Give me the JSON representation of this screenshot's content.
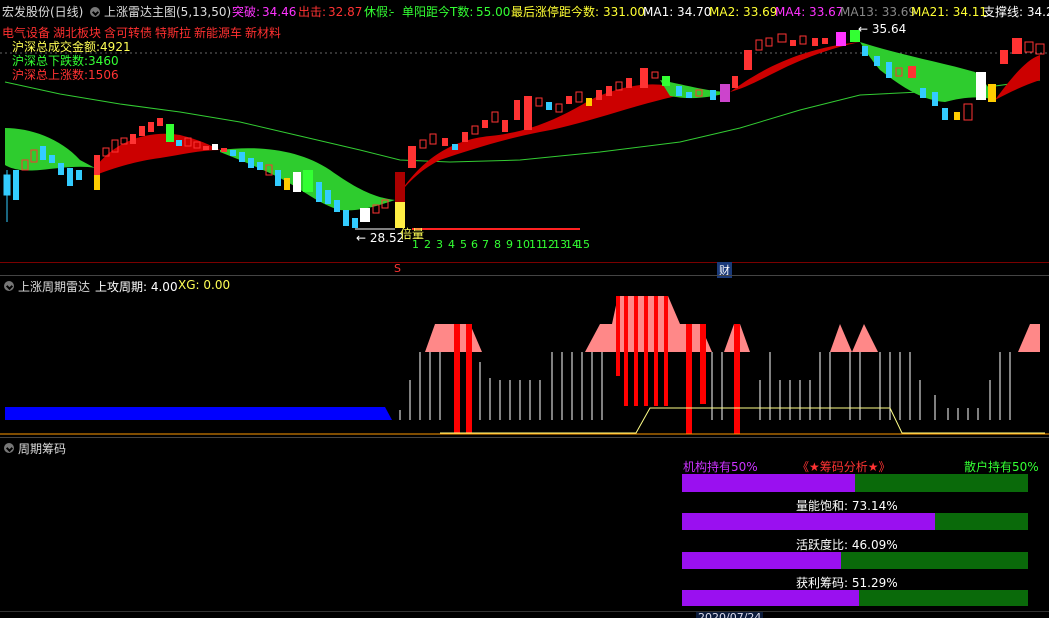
{
  "header": {
    "stock": "宏发股份(日线)",
    "indicator": "上涨雷达主图(5,13,50)",
    "breakout_label": "突破:",
    "breakout_value": "34.46",
    "exit_label": "出击:",
    "exit_value": "32.87",
    "rest_label": "休假:",
    "rest_value": "-",
    "single_sun_label": "单阳距今T数:",
    "single_sun_value": "55.00",
    "last_limit_label": "最后涨停距今数:",
    "last_limit_value": "331.00",
    "ma1": "MA1: 34.70",
    "ma2": "MA2: 33.69",
    "ma4": "MA4: 33.67",
    "ma13": "MA13: 33.69",
    "ma21": "MA21: 34.11",
    "support": "支撑线: 34.2"
  },
  "sectors": [
    "电气设备",
    "湖北板块",
    "含可转债",
    "特斯拉",
    "新能源车",
    "新材料"
  ],
  "market_stats": {
    "turnover": "沪深总成交金额:4921",
    "down": "沪深总下跌数:3460",
    "up": "沪深总上涨数:1506"
  },
  "chart_annotations": {
    "high": "35.64",
    "low": "28.52",
    "volume_tag": "倍量",
    "count_labels": [
      "1",
      "2",
      "3",
      "4",
      "5",
      "6",
      "7",
      "8",
      "9",
      "10",
      "11",
      "12",
      "13",
      "14",
      "15"
    ],
    "marker_s": "S",
    "marker_cai": "财"
  },
  "panel2": {
    "title": "上涨周期雷达",
    "cycle_label": "上攻周期: 4.00",
    "xg_label": "XG: 0.00"
  },
  "panel3": {
    "title": "周期筹码",
    "inst_label": "机构持有50%",
    "analysis_label": "《★筹码分析★》",
    "retail_label": "散户持有50%",
    "bars": [
      {
        "label": "量能饱和: 73.14%",
        "value": 73.14
      },
      {
        "label": "活跃度比: 46.09%",
        "value": 46.09
      },
      {
        "label": "获利筹码: 51.29%",
        "value": 51.29
      }
    ],
    "inst_value": 50
  },
  "footer": {
    "date": "2020/07/24"
  },
  "colors": {
    "red_cloud": "#cc0000",
    "green_cloud": "#33cc33",
    "purple": "#9a10f0",
    "dark_green": "#0a6a0a",
    "blue_bar": "#0000ff"
  }
}
